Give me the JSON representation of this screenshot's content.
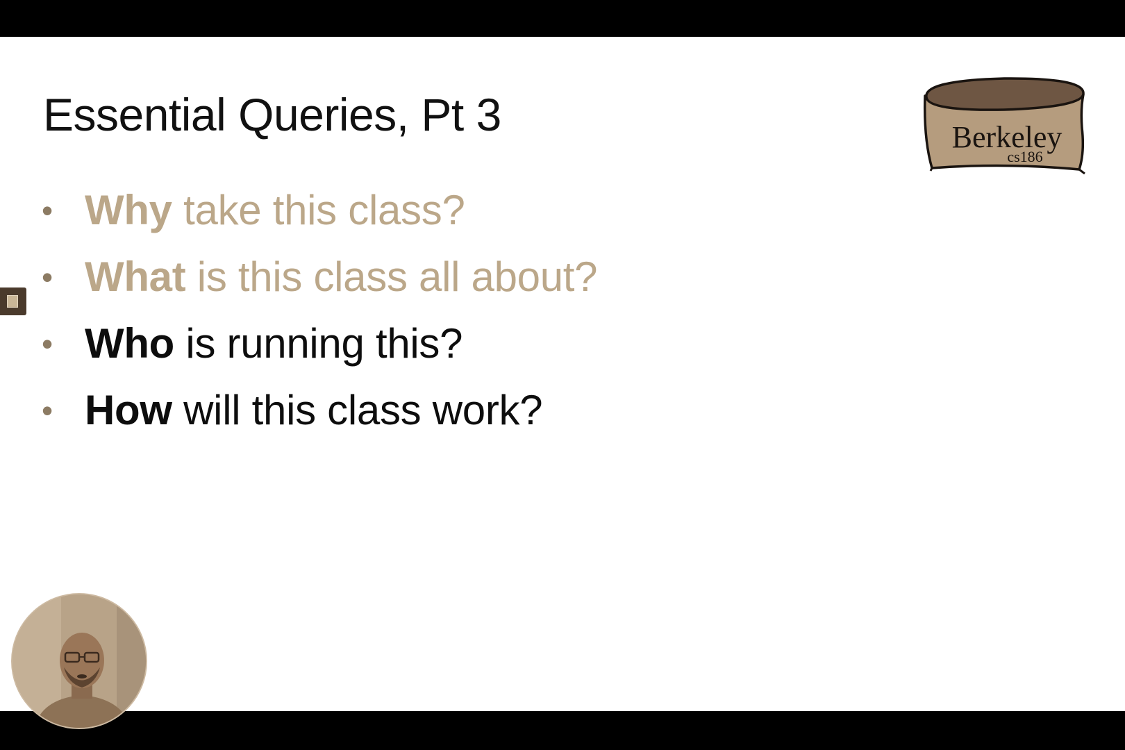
{
  "slide": {
    "title": "Essential Queries, Pt 3",
    "logo": {
      "name": "Berkeley",
      "course": "cs186"
    },
    "bullets": [
      {
        "bold": "Why",
        "rest": " take this class?",
        "state": "dimmed"
      },
      {
        "bold": "What",
        "rest": " is this class all about?",
        "state": "dimmed"
      },
      {
        "bold": "Who",
        "rest": " is running this?",
        "state": "active"
      },
      {
        "bold": "How",
        "rest": " will this class work?",
        "state": "active"
      }
    ]
  },
  "colors": {
    "dimmed_text": "#bba789",
    "active_text": "#0d0d0d",
    "bullet_dot": "#8c7b63",
    "logo_top": "#6e5643",
    "logo_body": "#b59c7e"
  },
  "overlays": {
    "webcam": "presenter-webcam",
    "side_handle_icon": "slide-navigator-handle-icon"
  }
}
